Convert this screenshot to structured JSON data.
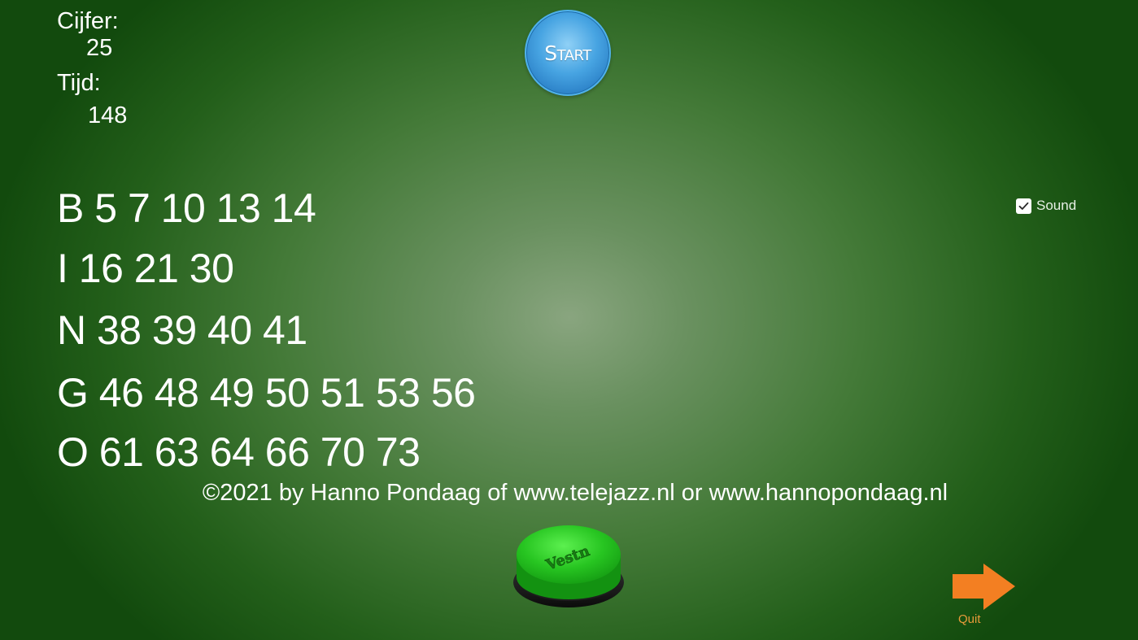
{
  "stats": {
    "cijfer_label": "Cijfer:",
    "cijfer_value": "25",
    "tijd_label": "Tijd:",
    "tijd_value": "148"
  },
  "start_button": {
    "label": "Start"
  },
  "sound": {
    "label": "Sound",
    "checked": true
  },
  "bingo_rows": [
    "B 5 7 10 13 14",
    "I 16 21 30",
    "N 38 39 40 41",
    "G 46 48 49 50 51 53 56",
    "O 61 63 64 66 70 73"
  ],
  "copyright": "©2021 by Hanno Pondaag of www.telejazz.nl or www.hannopondaag.nl",
  "green_button": {
    "label": "Vestn",
    "icon": "big-green-push-button-icon"
  },
  "quit": {
    "label": "Quit",
    "icon": "arrow-right-icon"
  },
  "colors": {
    "background_center": "#89a57f",
    "background_edge": "#124a0d",
    "start_button": "#2a7fc6",
    "quit_arrow": "#f37f22",
    "green_button": "#22c51f"
  }
}
